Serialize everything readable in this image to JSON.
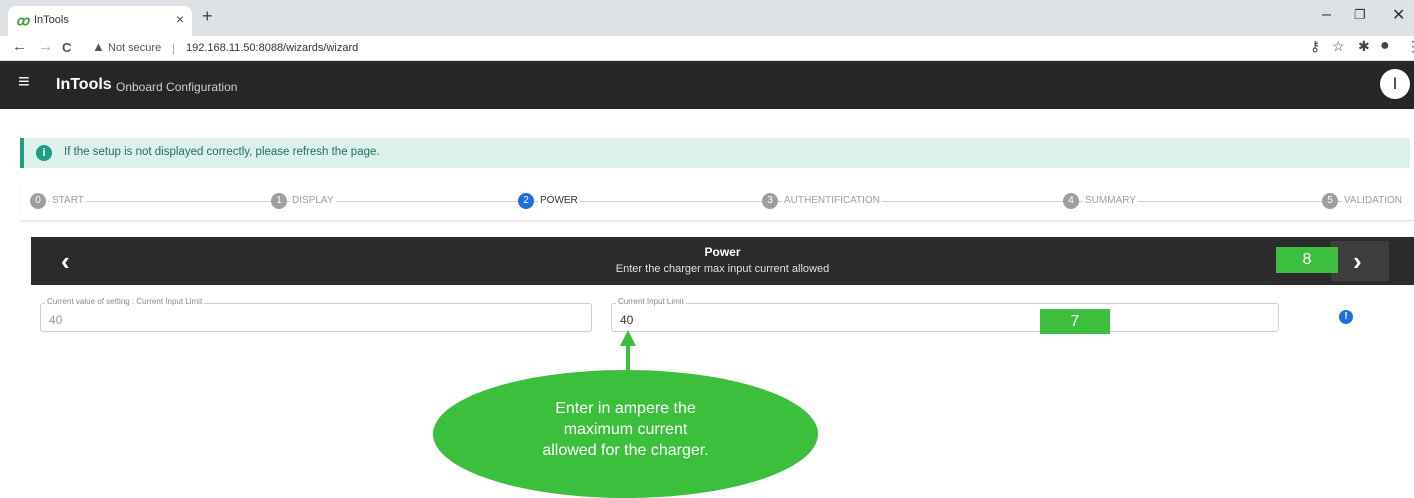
{
  "browser": {
    "tab_title": "InTools",
    "tab_close": "×",
    "new_tab": "+",
    "security_label": "Not secure",
    "url": "192.168.11.50:8088/wizards/wizard",
    "window_controls": {
      "minimize": "–",
      "maximize": "❐",
      "close": "✕"
    },
    "nav": {
      "back": "←",
      "forward": "→",
      "reload": "C"
    }
  },
  "app": {
    "title": "InTools",
    "subtitle": "Onboard Configuration",
    "avatar_initial": "I"
  },
  "banner": {
    "text": "If the setup is not displayed correctly, please refresh the page.",
    "icon": "i"
  },
  "stepper": {
    "steps": [
      {
        "number": "0",
        "label": "START",
        "active": false
      },
      {
        "number": "1",
        "label": "DISPLAY",
        "active": false
      },
      {
        "number": "2",
        "label": "POWER",
        "active": true
      },
      {
        "number": "3",
        "label": "AUTHENTIFICATION",
        "active": false
      },
      {
        "number": "4",
        "label": "SUMMARY",
        "active": false
      },
      {
        "number": "5",
        "label": "VALIDATION",
        "active": false
      }
    ]
  },
  "power": {
    "title": "Power",
    "subtitle": "Enter the charger max input current allowed",
    "prev": "‹",
    "next": "›"
  },
  "fields": {
    "current_value_label": "Current value of setting : Current Input Limit",
    "current_value": "40",
    "input_label": "Current Input Limit",
    "input_value": "40",
    "help_icon": "!"
  },
  "annotations": {
    "badge_7": "7",
    "badge_8": "8",
    "callout_lines": [
      "Enter in ampere the",
      "maximum current",
      "allowed for the charger."
    ]
  },
  "colors": {
    "accent_green": "#3cbf3c",
    "teal": "#1f9d84",
    "active_blue": "#1e6fd9",
    "header_dark": "#262626"
  }
}
